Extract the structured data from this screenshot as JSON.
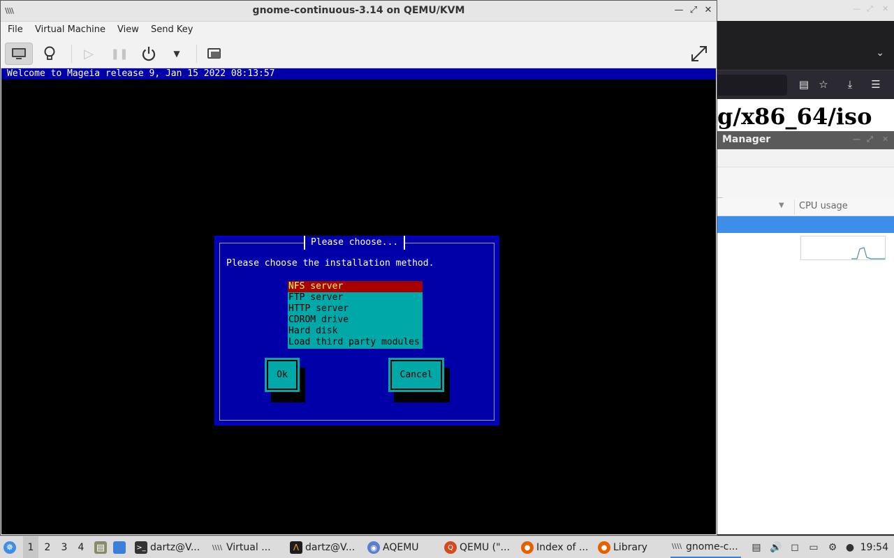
{
  "background": {
    "browser_heading": "g/x86_64/iso",
    "sysmon_title": "Manager",
    "sysmon_column": "CPU usage"
  },
  "vm_window": {
    "title": "gnome-continuous-3.14 on QEMU/KVM",
    "menu": [
      "File",
      "Virtual Machine",
      "View",
      "Send Key"
    ],
    "toolbar_icons": [
      "console-icon",
      "lightbulb-icon",
      "play-icon",
      "pause-icon",
      "power-icon",
      "dropdown-arrow-icon",
      "snapshots-icon",
      "fullscreen-icon"
    ]
  },
  "console": {
    "banner": "Welcome to Mageia release 9, Jan 15 2022 08:13:57",
    "dialog": {
      "title": "Please choose...",
      "prompt": "Please choose the installation method.",
      "options": [
        "NFS server",
        "FTP server",
        "HTTP server",
        "CDROM drive",
        "Hard disk",
        "Load third party modules"
      ],
      "selected_index": 0,
      "ok_label": "Ok",
      "cancel_label": "Cancel"
    },
    "colors": {
      "dialog_bg": "#0000a8",
      "list_bg": "#00a8a8",
      "selected_bg": "#a80000",
      "selected_fg": "#ffff55"
    }
  },
  "taskbar": {
    "workspaces": [
      "1",
      "2",
      "3",
      "4"
    ],
    "current_workspace": "1",
    "tasks": [
      {
        "label": "dartz@V...",
        "icon": "terminal-icon"
      },
      {
        "label": "Virtual ...",
        "icon": "virt-manager-icon"
      },
      {
        "label": "dartz@V...",
        "icon": "terminal-icon"
      },
      {
        "label": "AQEMU",
        "icon": "aqemu-icon"
      },
      {
        "label": "QEMU (\"...",
        "icon": "qemu-icon"
      },
      {
        "label": "Index of ...",
        "icon": "firefox-icon"
      },
      {
        "label": "Library",
        "icon": "firefox-icon"
      },
      {
        "label": "gnome-c...",
        "icon": "virt-manager-icon"
      }
    ],
    "active_task_index": 7,
    "clock": "19:54"
  }
}
